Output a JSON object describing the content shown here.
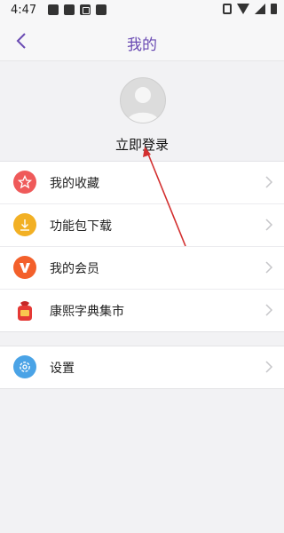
{
  "status": {
    "time": "4:47"
  },
  "header": {
    "title": "我的"
  },
  "profile": {
    "login_text": "立即登录"
  },
  "menu": [
    {
      "label": "我的收藏",
      "icon": "star-icon",
      "color": "#ef5a5a"
    },
    {
      "label": "功能包下载",
      "icon": "download-icon",
      "color": "#f2b024"
    },
    {
      "label": "我的会员",
      "icon": "vip-v-icon",
      "color": "#f3602b"
    },
    {
      "label": "康熙字典集市",
      "icon": "bag-icon",
      "color": "#e53935"
    }
  ],
  "settings": {
    "label": "设置",
    "icon": "gear-icon",
    "color": "#4aa3e6"
  }
}
